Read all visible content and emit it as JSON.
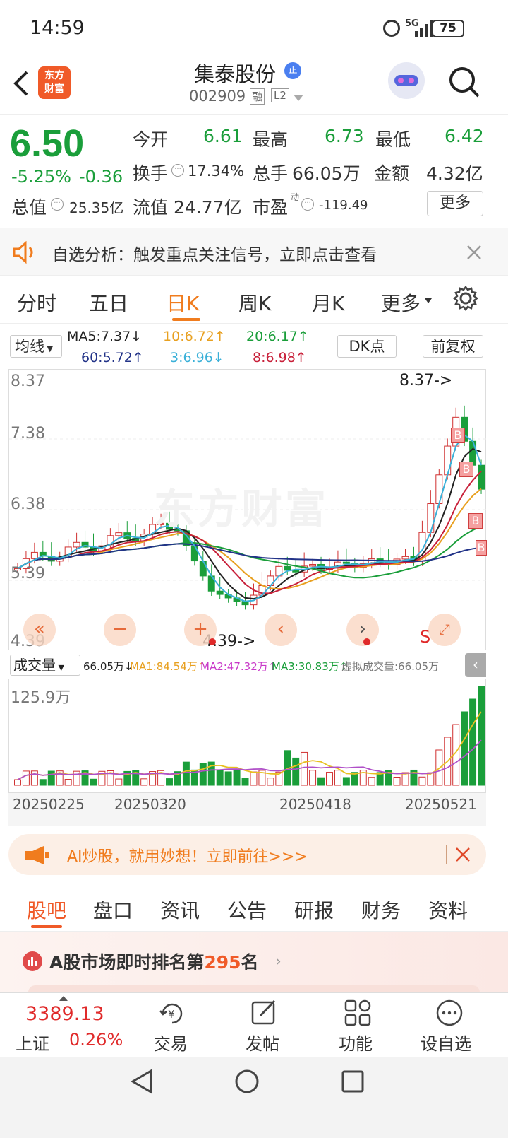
{
  "status_bar": {
    "time": "14:59",
    "network": "5G",
    "battery": "75"
  },
  "header": {
    "logo_line1": "东方",
    "logo_line2": "财富",
    "stock_name": "集泰股份",
    "stock_code": "002909",
    "badge_rong": "融",
    "badge_l2": "L2",
    "name_badge": "正"
  },
  "quote": {
    "price": "6.50",
    "change_pct": "-5.25%",
    "change_amt": "-0.36",
    "open_label": "今开",
    "open": "6.61",
    "high_label": "最高",
    "high": "6.73",
    "low_label": "最低",
    "low": "6.42",
    "turnover_label": "换手",
    "turnover": "17.34%",
    "volume_label": "总手",
    "volume": "66.05万",
    "amount_label": "金额",
    "amount": "4.32亿",
    "mktcap_label": "总值",
    "mktcap": "25.35亿",
    "float_label": "流值",
    "float_cap": "24.77亿",
    "pe_label": "市盈",
    "pe_sup": "动",
    "pe": "-119.49",
    "more_button": "更多"
  },
  "notice": {
    "text": "自选分析：触发重点关注信号，立即点击查看"
  },
  "period_tabs": [
    "分时",
    "五日",
    "日K",
    "周K",
    "月K",
    "更多"
  ],
  "active_period": "日K",
  "indicators": {
    "ma_select": "均线",
    "ma5": "MA5:7.37↓",
    "ma10": "10:6.72↑",
    "ma20": "20:6.17↑",
    "ma60": "60:5.72↑",
    "ma3": "3:6.96↓",
    "ma8": "8:6.98↑",
    "dk_button": "DK点",
    "adjust_button": "前复权"
  },
  "kline": {
    "y_labels": [
      "8.37",
      "7.38",
      "6.38",
      "5.39",
      "4.39"
    ],
    "high_marker": "8.37->",
    "low_marker": "4.39->",
    "watermark": "东方财富",
    "s_mark": "S",
    "b_mark": "B"
  },
  "volume_section": {
    "select": "成交量",
    "vol": "66.05万↓",
    "ma1": "MA1:84.54万↑",
    "ma2": "MA2:47.32万↑",
    "ma3": "MA3:30.83万↑",
    "virtual": "虚拟成交量:66.05万",
    "y_max": "125.9万",
    "dates": [
      "20250225",
      "20250320",
      "20250418",
      "20250521"
    ]
  },
  "ai_banner": {
    "text": "AI炒股，就用妙想！立即前往>>>"
  },
  "content_tabs": [
    "股吧",
    "盘口",
    "资讯",
    "公告",
    "研报",
    "财务",
    "资料"
  ],
  "rank": {
    "prefix": "A股市场即时排名第",
    "number": "295",
    "suffix": "名"
  },
  "bottom_bar": {
    "index_value": "3389.13",
    "index_name": "上证",
    "index_change": "0.26%",
    "trade": "交易",
    "post": "发帖",
    "functions": "功能",
    "set_watch": "设自选"
  },
  "colors": {
    "up": "#e02a2a",
    "down": "#1a9e3a",
    "accent": "#f07c1e"
  }
}
